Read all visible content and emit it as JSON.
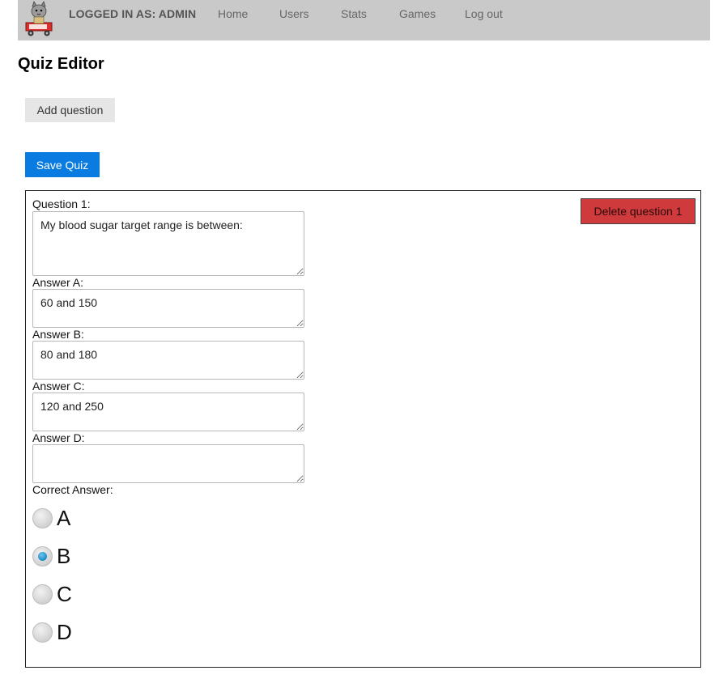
{
  "nav": {
    "user_label": "LOGGED IN AS: ADMIN",
    "links": [
      "Home",
      "Users",
      "Stats",
      "Games",
      "Log out"
    ]
  },
  "page": {
    "title": "Quiz Editor",
    "add_question_label": "Add question",
    "save_quiz_label": "Save Quiz"
  },
  "question": {
    "label": "Question 1:",
    "text": "My blood sugar target range is between:",
    "delete_label": "Delete question 1",
    "answers": [
      {
        "label": "Answer A:",
        "value": "60 and 150"
      },
      {
        "label": "Answer B:",
        "value": "80 and 180"
      },
      {
        "label": "Answer C:",
        "value": "120 and 250"
      },
      {
        "label": "Answer D:",
        "value": ""
      }
    ],
    "correct_label": "Correct Answer:",
    "options": [
      "A",
      "B",
      "C",
      "D"
    ],
    "selected": "B"
  },
  "colors": {
    "navbar": "#c9c9c9",
    "save_button": "#0a7be0",
    "delete_button": "#cf3a3c"
  }
}
